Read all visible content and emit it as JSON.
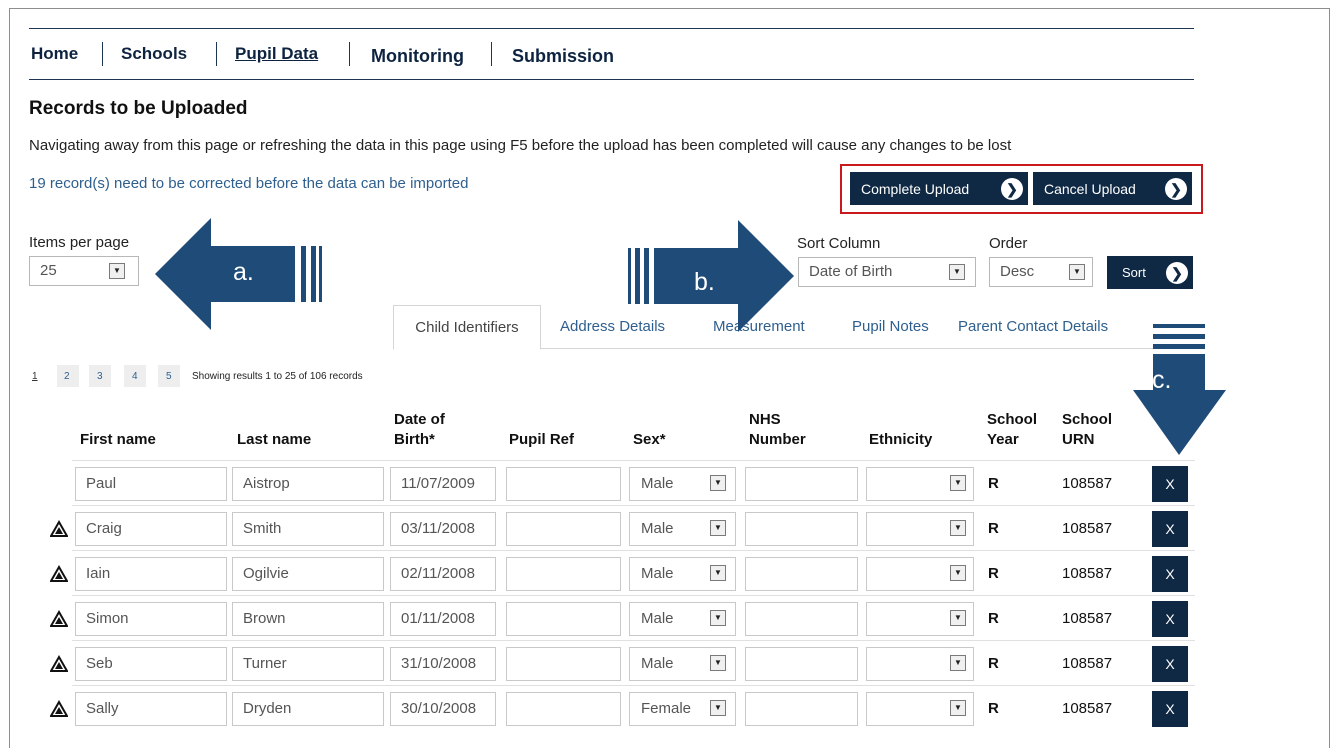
{
  "nav": {
    "items": [
      {
        "label": "Home",
        "active": false
      },
      {
        "label": "Schools",
        "active": false
      },
      {
        "label": "Pupil Data",
        "active": true
      },
      {
        "label": "Monitoring",
        "active": false
      },
      {
        "label": "Submission",
        "active": false
      }
    ]
  },
  "page": {
    "title": "Records to be Uploaded",
    "warning": "Navigating away from this page or refreshing the data in this page using F5 before the upload has been completed will cause any changes to be lost",
    "correction_notice": "19 record(s) need to be corrected before the data can be imported"
  },
  "actions": {
    "complete_upload": "Complete Upload",
    "cancel_upload": "Cancel Upload",
    "sort": "Sort"
  },
  "controls": {
    "items_per_page_label": "Items per page",
    "items_per_page_value": "25",
    "sort_column_label": "Sort Column",
    "sort_column_value": "Date of Birth",
    "order_label": "Order",
    "order_value": "Desc"
  },
  "annotations": {
    "a": "a.",
    "b": "b.",
    "c": "c."
  },
  "tabs": [
    {
      "label": "Child Identifiers",
      "active": true
    },
    {
      "label": "Address Details",
      "active": false
    },
    {
      "label": "Measurement",
      "active": false
    },
    {
      "label": "Pupil Notes",
      "active": false
    },
    {
      "label": "Parent Contact Details",
      "active": false
    }
  ],
  "pagination": {
    "pages": [
      "1",
      "2",
      "3",
      "4",
      "5"
    ],
    "current": "1",
    "summary": "Showing results 1 to 25 of 106 records"
  },
  "table": {
    "headers": {
      "first_name": "First name",
      "last_name": "Last name",
      "dob_line1": "Date of",
      "dob_line2": "Birth*",
      "pupil_ref": "Pupil Ref",
      "sex": "Sex*",
      "nhs_line1": "NHS",
      "nhs_line2": "Number",
      "ethnicity": "Ethnicity",
      "year_line1": "School",
      "year_line2": "Year",
      "urn_line1": "School",
      "urn_line2": "URN"
    },
    "delete_label": "X",
    "rows": [
      {
        "warning": false,
        "first": "Paul",
        "last": "Aistrop",
        "dob": "11/07/2009",
        "ref": "",
        "sex": "Male",
        "nhs": "",
        "ethnicity": "",
        "year": "R",
        "urn": "108587"
      },
      {
        "warning": true,
        "first": "Craig",
        "last": "Smith",
        "dob": "03/11/2008",
        "ref": "",
        "sex": "Male",
        "nhs": "",
        "ethnicity": "",
        "year": "R",
        "urn": "108587"
      },
      {
        "warning": true,
        "first": "Iain",
        "last": "Ogilvie",
        "dob": "02/11/2008",
        "ref": "",
        "sex": "Male",
        "nhs": "",
        "ethnicity": "",
        "year": "R",
        "urn": "108587"
      },
      {
        "warning": true,
        "first": "Simon",
        "last": "Brown",
        "dob": "01/11/2008",
        "ref": "",
        "sex": "Male",
        "nhs": "",
        "ethnicity": "",
        "year": "R",
        "urn": "108587"
      },
      {
        "warning": true,
        "first": "Seb",
        "last": "Turner",
        "dob": "31/10/2008",
        "ref": "",
        "sex": "Male",
        "nhs": "",
        "ethnicity": "",
        "year": "R",
        "urn": "108587"
      },
      {
        "warning": true,
        "first": "Sally",
        "last": "Dryden",
        "dob": "30/10/2008",
        "ref": "",
        "sex": "Female",
        "nhs": "",
        "ethnicity": "",
        "year": "R",
        "urn": "108587"
      }
    ]
  },
  "colors": {
    "navy": "#0f2844",
    "link_blue": "#2e5f8e",
    "highlight_red": "#c8191f",
    "arrow_blue": "#1f4b78"
  }
}
